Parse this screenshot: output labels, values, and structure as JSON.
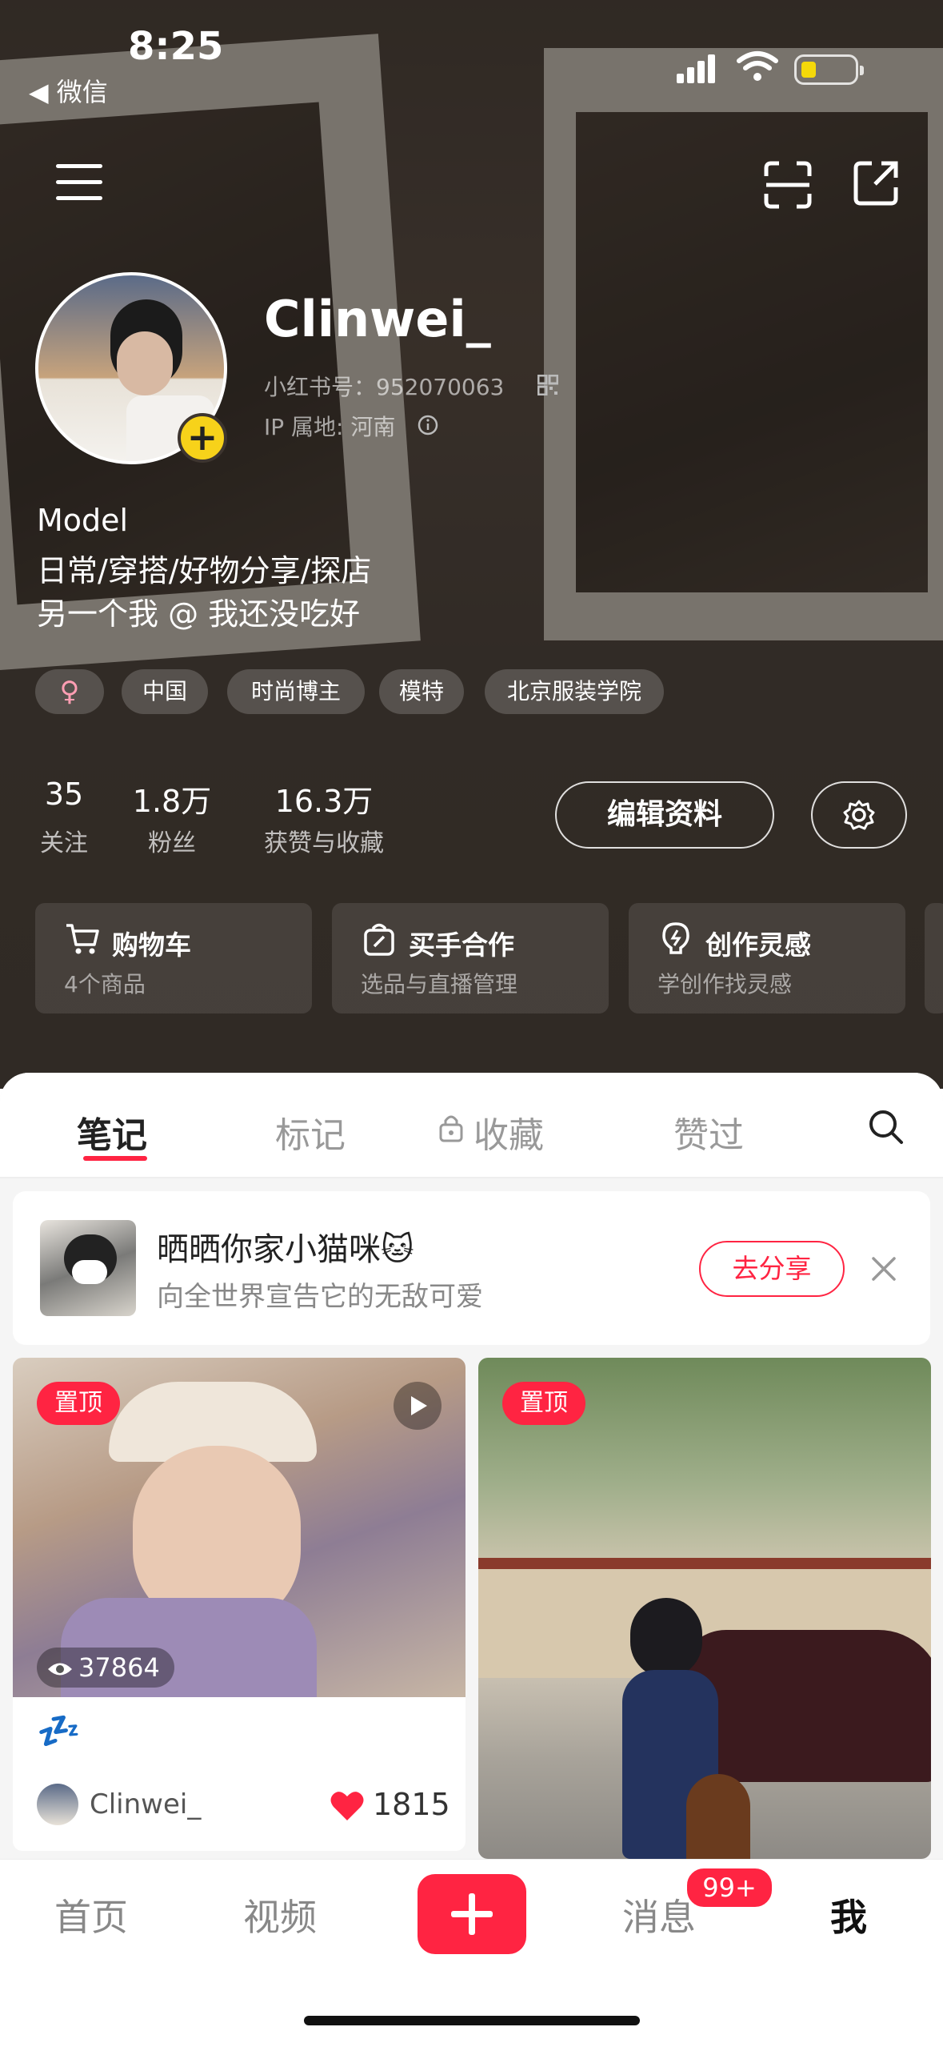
{
  "status_bar": {
    "time": "8:25",
    "back_label": "◀ 微信"
  },
  "profile": {
    "name": "Clinwei_",
    "id_label": "小红书号：",
    "id_value": "952070063",
    "ip_label": "IP 属地: 河南",
    "bio": [
      "Model",
      "日常/穿搭/好物分享/探店",
      "另一个我 @ 我还没吃好"
    ],
    "gender_symbol": "♀",
    "tags": [
      "中国",
      "时尚博主",
      "模特",
      "北京服装学院"
    ]
  },
  "stats": [
    {
      "value": "35",
      "label": "关注"
    },
    {
      "value": "1.8万",
      "label": "粉丝"
    },
    {
      "value": "16.3万",
      "label": "获赞与收藏"
    }
  ],
  "actions": {
    "edit_profile": "编辑资料"
  },
  "cards": [
    {
      "title": "购物车",
      "subtitle": "4个商品",
      "icon": "cart-icon"
    },
    {
      "title": "买手合作",
      "subtitle": "选品与直播管理",
      "icon": "bag-icon"
    },
    {
      "title": "创作灵感",
      "subtitle": "学创作找灵感",
      "icon": "bulb-icon"
    }
  ],
  "tabs": [
    {
      "label": "笔记",
      "active": true
    },
    {
      "label": "标记",
      "active": false
    },
    {
      "label": "收藏",
      "active": false,
      "locked": true
    },
    {
      "label": "赞过",
      "active": false
    }
  ],
  "banner": {
    "title": "晒晒你家小猫咪",
    "emoji": "🐱",
    "subtitle": "向全世界宣告它的无敌可爱",
    "button": "去分享"
  },
  "feed": [
    {
      "pinned_label": "置顶",
      "views": "37864",
      "title": "💤",
      "author": "Clinwei_",
      "likes": "1815",
      "video": true
    },
    {
      "pinned_label": "置顶",
      "video": false
    }
  ],
  "bottom_nav": {
    "items": [
      "首页",
      "视频",
      "消息",
      "我"
    ],
    "message_badge": "99+",
    "active": "我"
  },
  "colors": {
    "accent": "#ff2442",
    "badge_yellow": "#f7d21a",
    "hero_bg": "#3d352f"
  }
}
